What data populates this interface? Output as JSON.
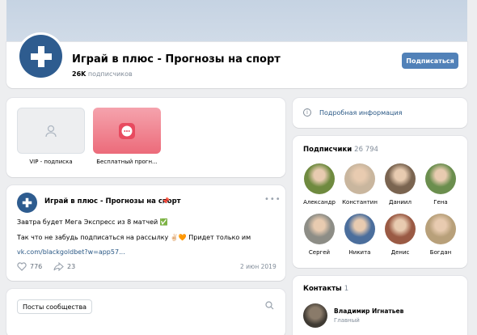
{
  "group": {
    "title": "Играй в плюс - Прогнозы на спорт",
    "subscribers_count": "26K",
    "subscribers_suffix": "подписчиков",
    "subscribe_label": "Подписаться",
    "avatar_icon": "plus-cross-icon",
    "brand_color": "#2e5c8f"
  },
  "services": {
    "items": [
      {
        "label": "VIP - подписка",
        "icon": "user-icon"
      },
      {
        "label": "Бесплатный прогн...",
        "icon": "chat-bubble-icon"
      }
    ]
  },
  "post": {
    "author": "Играй в плюс - Прогнозы на спорт",
    "line1": "Завтра будет Мега Экспресс из 8 матчей ✅",
    "line2": "Так что не забудь подписаться на рассылку ✌🏻🧡 Придет только им",
    "link": "vk.com/blackgoldbet?w=app57...",
    "likes": "776",
    "shares": "23",
    "date": "2 июн 2019"
  },
  "tabs": {
    "community_posts": "Посты сообщества"
  },
  "info": {
    "label": "Подробная информация"
  },
  "subscribers": {
    "title": "Подписчики",
    "count": "26 794",
    "members": [
      {
        "name": "Александр",
        "color": "#6f8a3f"
      },
      {
        "name": "Константин",
        "color": "#c9b69e"
      },
      {
        "name": "Даниил",
        "color": "#7a6450"
      },
      {
        "name": "Гена",
        "color": "#6b8e4e"
      },
      {
        "name": "Сергей",
        "color": "#8d8d86"
      },
      {
        "name": "Никита",
        "color": "#4b6e9c"
      },
      {
        "name": "Денис",
        "color": "#9a5a44"
      },
      {
        "name": "Богдан",
        "color": "#b8a07a"
      }
    ]
  },
  "contacts": {
    "title": "Контакты",
    "count": "1",
    "name": "Владимир Игнатьев",
    "role": "Главный"
  }
}
